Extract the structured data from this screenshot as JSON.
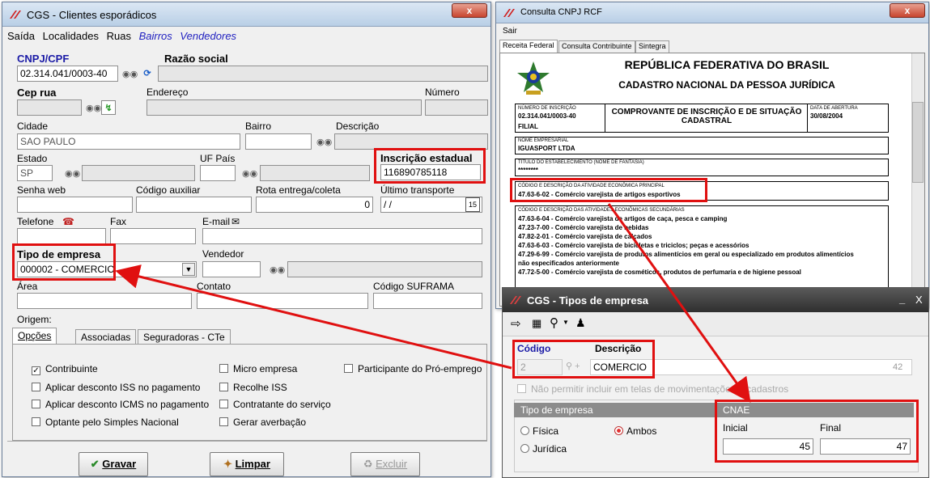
{
  "win1": {
    "title": "CGS - Clientes esporádicos",
    "close": "x",
    "menu": [
      "Saída",
      "Localidades",
      "Ruas",
      "Bairros",
      "Vendedores"
    ],
    "cnpj_label": "CNPJ/CPF",
    "cnpj_value": "02.314.041/0003-40",
    "razao_label": "Razão social",
    "cep_label": "Cep rua",
    "endereco_label": "Endereço",
    "numero_label": "Número",
    "cidade_label": "Cidade",
    "cidade_value": "SAO PAULO",
    "bairro_label": "Bairro",
    "descricao_label": "Descrição",
    "estado_label": "Estado",
    "estado_value": "SP",
    "ufpais_label": "UF País",
    "ie_label": "Inscrição estadual",
    "ie_value": "116890785118",
    "senha_label": "Senha web",
    "codaux_label": "Código auxiliar",
    "rota_label": "Rota entrega/coleta",
    "rota_value": "0",
    "ultimo_label": "Último transporte",
    "ultimo_value": "/ /",
    "cal_icon": "15",
    "telefone_label": "Telefone",
    "fax_label": "Fax",
    "email_label": "E-mail",
    "tipo_label": "Tipo de empresa",
    "tipo_value": "000002 - COMERCIO",
    "vendedor_label": "Vendedor",
    "area_label": "Área",
    "contato_label": "Contato",
    "suframa_label": "Código SUFRAMA",
    "origem_label": "Origem:",
    "tabs": [
      "Opções",
      "Associadas",
      "Seguradoras - CTe"
    ],
    "checks": [
      {
        "label": "Contribuinte",
        "checked": true
      },
      {
        "label": "Aplicar desconto ISS no pagamento",
        "checked": false
      },
      {
        "label": "Aplicar desconto ICMS no pagamento",
        "checked": false
      },
      {
        "label": "Optante pelo Simples Nacional",
        "checked": false
      },
      {
        "label": "Micro empresa",
        "checked": false
      },
      {
        "label": "Recolhe ISS",
        "checked": false
      },
      {
        "label": "Contratante do serviço",
        "checked": false
      },
      {
        "label": "Gerar averbação",
        "checked": false
      },
      {
        "label": "Participante do Pró-emprego",
        "checked": false
      }
    ],
    "btn_gravar": "Gravar",
    "btn_limpar": "Limpar",
    "btn_excluir": "Excluir"
  },
  "win2": {
    "title": "Consulta CNPJ RCF",
    "close": "x",
    "menu": "Sair",
    "tabs": [
      "Receita Federal",
      "Consulta Contribuinte",
      "Sintegra"
    ],
    "doc_title1": "REPÚBLICA FEDERATIVA DO BRASIL",
    "doc_title2": "CADASTRO NACIONAL DA PESSOA JURÍDICA",
    "num_insc_label": "NÚMERO DE INSCRIÇÃO",
    "num_insc_value": "02.314.041/0003-40",
    "filial": "FILIAL",
    "comprovante": "COMPROVANTE DE INSCRIÇÃO E DE SITUAÇÃO CADASTRAL",
    "data_abertura_label": "DATA DE ABERTURA",
    "data_abertura_value": "30/08/2004",
    "nome_label": "NOME EMPRESARIAL",
    "nome_value": "IGUASPORT LTDA",
    "fantasia_label": "TÍTULO DO ESTABELECIMENTO (NOME DE FANTASIA)",
    "fantasia_value": "********",
    "principal_label": "CÓDIGO E DESCRIÇÃO DA ATIVIDADE ECONÔMICA PRINCIPAL",
    "principal_value": "47.63-6-02 - Comércio varejista de artigos esportivos",
    "secundarias_label": "CÓDIGO E DESCRIÇÃO DAS ATIVIDADES ECONÔMICAS SECUNDÁRIAS",
    "secundarias": [
      "47.63-6-04 - Comércio varejista de artigos de caça, pesca e camping",
      "47.23-7-00 - Comércio varejista de bebidas",
      "47.82-2-01 - Comércio varejista de calçados",
      "47.63-6-03 - Comércio varejista de bicicletas e triciclos; peças e acessórios",
      "47.29-6-99 - Comércio varejista de produtos alimentícios em geral ou especializado em produtos alimentícios",
      "não especificados anteriormente",
      "47.72-5-00 - Comércio varejista de cosméticos, produtos de perfumaria e de higiene pessoal"
    ]
  },
  "win3": {
    "title": "CGS - Tipos de empresa",
    "min": "_",
    "close": "X",
    "codigo_label": "Código",
    "descricao_label": "Descrição",
    "codigo_value": "2",
    "descricao_value": "COMERCIO",
    "count": "42",
    "nao_permitir": "Não permitir incluir em telas de movimentações e cadastros",
    "tipo_section": "Tipo de empresa",
    "cnae_section": "CNAE",
    "radios": [
      {
        "label": "Física",
        "on": false
      },
      {
        "label": "Ambos",
        "on": true
      },
      {
        "label": "Jurídica",
        "on": false
      }
    ],
    "inicial_label": "Inicial",
    "final_label": "Final",
    "inicial_value": "45",
    "final_value": "47"
  },
  "colors": {
    "annotation": "#e01010",
    "title_blue": "#1a1aa6"
  }
}
